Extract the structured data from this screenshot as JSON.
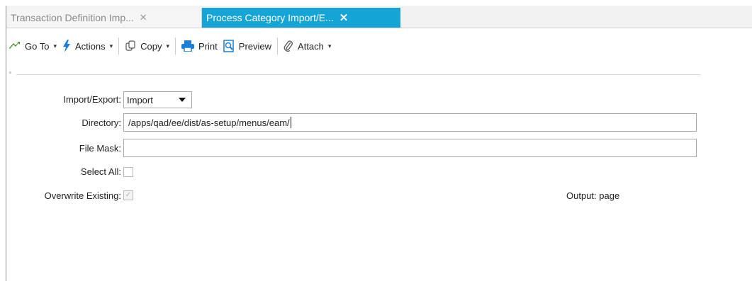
{
  "tabs": [
    {
      "label": "Transaction Definition Imp...",
      "close": "✕",
      "active": false
    },
    {
      "label": "Process Category Import/E...",
      "close": "✕",
      "active": true
    }
  ],
  "toolbar": {
    "goto_label": "Go To",
    "actions_label": "Actions",
    "copy_label": "Copy",
    "print_label": "Print",
    "preview_label": "Preview",
    "attach_label": "Attach",
    "caret": "▾",
    "icons": [
      "goto-arrow-icon",
      "lightning-icon",
      "copy-icon",
      "printer-icon",
      "preview-icon",
      "paperclip-icon"
    ],
    "colors": {
      "goto": "#4a8a2a",
      "actions": "#1a7fd6",
      "print": "#1a7fd6",
      "preview": "#1a7fd6"
    }
  },
  "form": {
    "import_export_label": "Import/Export:",
    "import_export_value": "Import",
    "directory_label": "Directory:",
    "directory_value": "/apps/qad/ee/dist/as-setup/menus/eam/",
    "file_mask_label": "File Mask:",
    "file_mask_value": "",
    "select_all_label": "Select All:",
    "select_all_checked": false,
    "overwrite_label": "Overwrite Existing:",
    "overwrite_checked": true,
    "checkmark": "✓",
    "output_label": "Output:",
    "output_value": "page"
  },
  "colors": {
    "active_tab": "#15a4d6",
    "inactive_tab_text": "#8a8a8a"
  }
}
